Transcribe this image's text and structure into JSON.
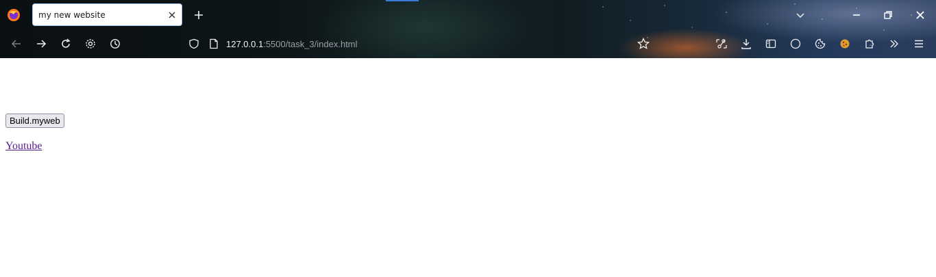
{
  "browser": {
    "tab": {
      "title": "my new website"
    },
    "address_bar": {
      "host": "127.0.0.1",
      "rest": ":5500/task_3/index.html"
    },
    "icons": {
      "app": "firefox-logo-icon",
      "tab_close": "close-icon",
      "new_tab": "plus-icon",
      "tab_list": "chevron-down-icon",
      "minimize": "minimize-icon",
      "restore": "restore-icon",
      "close": "close-icon",
      "back": "arrow-left-icon",
      "forward": "arrow-right-icon",
      "reload": "reload-icon",
      "settings": "gear-icon",
      "history": "clock-icon",
      "security": "shield-icon",
      "page": "page-icon",
      "bookmark": "star-icon",
      "screenshot": "scissors-icon",
      "downloads": "download-icon",
      "reader": "reader-view-icon",
      "circle": "circle-icon",
      "cookie": "cookie-icon",
      "extensions": "puzzle-icon",
      "overflow": "double-chevron-right-icon",
      "menu": "hamburger-menu-icon"
    }
  },
  "page": {
    "button_label": "Build.myweb",
    "link_text": "Youtube"
  },
  "colors": {
    "link_visited": "#551a8b",
    "tab_border": "#9ec1ef"
  }
}
